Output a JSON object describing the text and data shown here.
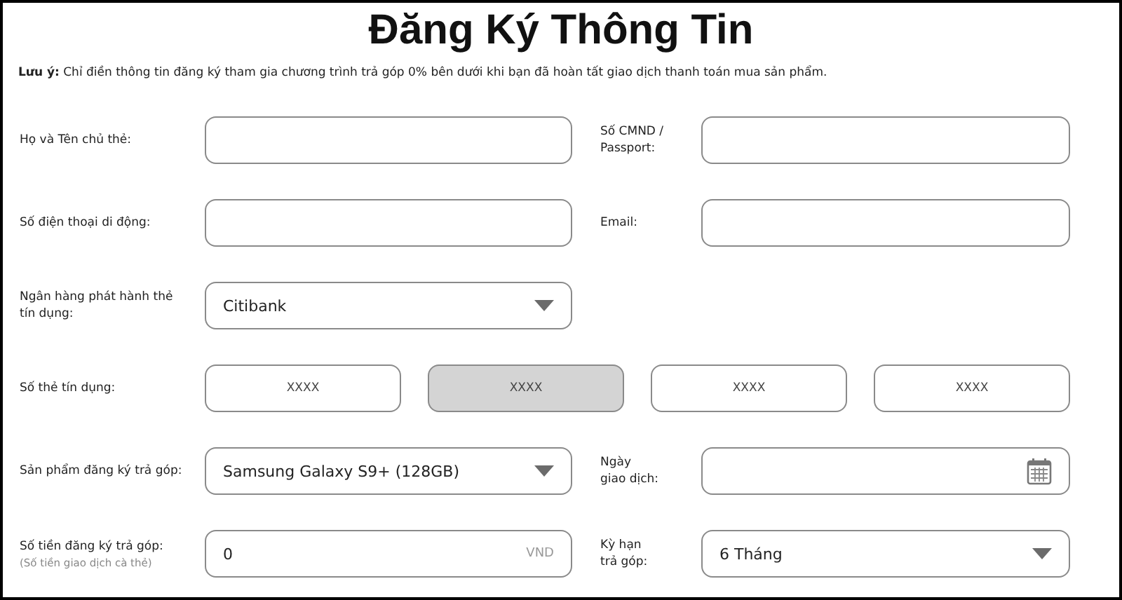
{
  "title": "Đăng Ký Thông Tin",
  "note": {
    "label": "Lưu ý:",
    "text": "Chỉ điền thông tin đăng ký tham gia chương trình trả góp 0% bên dưới khi bạn đã hoàn tất giao dịch thanh toán mua sản phẩm."
  },
  "rows": [
    {
      "fields": [
        {
          "label": "Họ và Tên chủ thẻ:",
          "kind": "text"
        },
        {
          "label": "Số CMND /\nPassport:",
          "kind": "text"
        }
      ]
    },
    {
      "fields": [
        {
          "label": "Số điện thoại di động:",
          "kind": "text"
        },
        {
          "label": "Email:",
          "kind": "text"
        }
      ]
    },
    {
      "fields": [
        {
          "label": "Ngân hàng phát hành thẻ\ntín dụng:",
          "kind": "select",
          "value": "Citibank"
        }
      ]
    },
    {
      "fields": [
        {
          "label": "Số thẻ tín dụng:",
          "kind": "card",
          "parts": [
            {
              "placeholder": "XXXX",
              "disabled": false
            },
            {
              "placeholder": "XXXX",
              "disabled": true
            },
            {
              "placeholder": "XXXX",
              "disabled": false
            },
            {
              "placeholder": "XXXX",
              "disabled": false
            }
          ]
        }
      ]
    },
    {
      "fields": [
        {
          "label": "Sản phẩm đăng ký trả góp:",
          "kind": "select",
          "value": "Samsung Galaxy S9+ (128GB)"
        },
        {
          "label": "Ngày\ngiao dịch:",
          "kind": "date"
        }
      ]
    },
    {
      "fields": [
        {
          "label": "Số tiền đăng ký trả góp:",
          "sublabel": "(Số tiền giao dịch cà thẻ)",
          "kind": "amount",
          "value": "0",
          "unit": "VND"
        },
        {
          "label": "Kỳ hạn\ntrả góp:",
          "kind": "select",
          "value": "6 Tháng"
        }
      ]
    }
  ]
}
